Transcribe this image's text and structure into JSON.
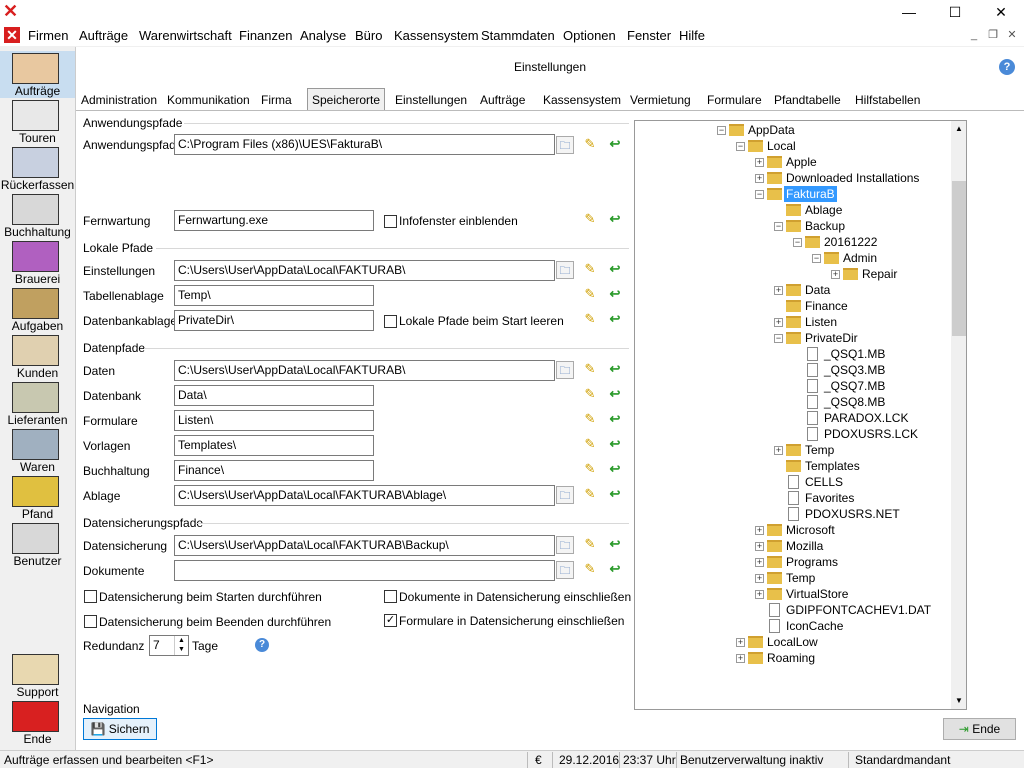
{
  "window": {
    "minimize": "—",
    "maximize": "☐",
    "close": "✕",
    "mdi_min": "_",
    "mdi_restore": "❐",
    "mdi_close": "✕"
  },
  "menu": [
    "Firmen",
    "Aufträge",
    "Warenwirtschaft",
    "Finanzen",
    "Analyse",
    "Büro",
    "Kassensystem",
    "Stammdaten",
    "Optionen",
    "Fenster",
    "Hilfe"
  ],
  "sidebar": [
    "Aufträge",
    "Touren",
    "Rückerfassen",
    "Buchhaltung",
    "Brauerei",
    "Aufgaben",
    "Kunden",
    "Lieferanten",
    "Waren",
    "Pfand",
    "Benutzer"
  ],
  "sidebar_bottom": [
    "Support",
    "Ende"
  ],
  "content_title": "Einstellungen",
  "tabs": [
    "Administration",
    "Kommunikation",
    "Firma",
    "Speicherorte",
    "Einstellungen",
    "Aufträge",
    "Kassensystem",
    "Vermietung",
    "Formulare",
    "Pfandtabelle",
    "Hilfstabellen"
  ],
  "active_tab": "Speicherorte",
  "groups": {
    "anwendung": {
      "title": "Anwendungspfade",
      "anwendungspfad_label": "Anwendungspfad",
      "anwendungspfad_value": "C:\\Program Files (x86)\\UES\\FakturaB\\",
      "fernwartung_label": "Fernwartung",
      "fernwartung_value": "Fernwartung.exe",
      "infofenster_label": "Infofenster einblenden"
    },
    "lokal": {
      "title": "Lokale Pfade",
      "einstellungen_label": "Einstellungen",
      "einstellungen_value": "C:\\Users\\User\\AppData\\Local\\FAKTURAB\\",
      "tabellenablage_label": "Tabellenablage",
      "tabellenablage_value": "Temp\\",
      "datenbankablage_label": "Datenbankablage",
      "datenbankablage_value": "PrivateDir\\",
      "lokale_check_label": "Lokale Pfade beim Start leeren"
    },
    "daten": {
      "title": "Datenpfade",
      "rows": [
        {
          "label": "Daten",
          "value": "C:\\Users\\User\\AppData\\Local\\FAKTURAB\\"
        },
        {
          "label": "Datenbank",
          "value": "Data\\"
        },
        {
          "label": "Formulare",
          "value": "Listen\\"
        },
        {
          "label": "Vorlagen",
          "value": "Templates\\"
        },
        {
          "label": "Buchhaltung",
          "value": "Finance\\"
        },
        {
          "label": "Ablage",
          "value": "C:\\Users\\User\\AppData\\Local\\FAKTURAB\\Ablage\\"
        }
      ]
    },
    "sicherung": {
      "title": "Datensicherungspfade",
      "datensicherung_label": "Datensicherung",
      "datensicherung_value": "C:\\Users\\User\\AppData\\Local\\FAKTURAB\\Backup\\",
      "dokumente_label": "Dokumente",
      "dokumente_value": "",
      "chk1": "Datensicherung beim Starten durchführen",
      "chk2": "Datensicherung beim Beenden durchführen",
      "chk3": "Dokumente in Datensicherung einschließen",
      "chk4": "Formulare in Datensicherung einschließen",
      "chk4_checked": true,
      "redundanz_label": "Redundanz",
      "redundanz_value": "7",
      "tage_label": "Tage"
    }
  },
  "tree": [
    {
      "label": "AppData",
      "level": 0,
      "type": "folder",
      "exp": "−"
    },
    {
      "label": "Local",
      "level": 1,
      "type": "folder",
      "exp": "−"
    },
    {
      "label": "Apple",
      "level": 2,
      "type": "folder",
      "exp": "+"
    },
    {
      "label": "Downloaded Installations",
      "level": 2,
      "type": "folder",
      "exp": "+"
    },
    {
      "label": "FakturaB",
      "level": 2,
      "type": "folder",
      "exp": "−",
      "selected": true
    },
    {
      "label": "Ablage",
      "level": 3,
      "type": "folder",
      "exp": ""
    },
    {
      "label": "Backup",
      "level": 3,
      "type": "folder",
      "exp": "−"
    },
    {
      "label": "20161222",
      "level": 4,
      "type": "folder",
      "exp": "−"
    },
    {
      "label": "Admin",
      "level": 5,
      "type": "folder",
      "exp": "−"
    },
    {
      "label": "Repair",
      "level": 6,
      "type": "folder",
      "exp": "+"
    },
    {
      "label": "Data",
      "level": 3,
      "type": "folder",
      "exp": "+"
    },
    {
      "label": "Finance",
      "level": 3,
      "type": "folder",
      "exp": ""
    },
    {
      "label": "Listen",
      "level": 3,
      "type": "folder",
      "exp": "+"
    },
    {
      "label": "PrivateDir",
      "level": 3,
      "type": "folder",
      "exp": "−"
    },
    {
      "label": "_QSQ1.MB",
      "level": 4,
      "type": "file",
      "exp": ""
    },
    {
      "label": "_QSQ3.MB",
      "level": 4,
      "type": "file",
      "exp": ""
    },
    {
      "label": "_QSQ7.MB",
      "level": 4,
      "type": "file",
      "exp": ""
    },
    {
      "label": "_QSQ8.MB",
      "level": 4,
      "type": "file",
      "exp": ""
    },
    {
      "label": "PARADOX.LCK",
      "level": 4,
      "type": "file",
      "exp": ""
    },
    {
      "label": "PDOXUSRS.LCK",
      "level": 4,
      "type": "file",
      "exp": ""
    },
    {
      "label": "Temp",
      "level": 3,
      "type": "folder",
      "exp": "+"
    },
    {
      "label": "Templates",
      "level": 3,
      "type": "folder",
      "exp": ""
    },
    {
      "label": "CELLS",
      "level": 3,
      "type": "file",
      "exp": ""
    },
    {
      "label": "Favorites",
      "level": 3,
      "type": "file",
      "exp": ""
    },
    {
      "label": "PDOXUSRS.NET",
      "level": 3,
      "type": "file",
      "exp": ""
    },
    {
      "label": "Microsoft",
      "level": 2,
      "type": "folder",
      "exp": "+"
    },
    {
      "label": "Mozilla",
      "level": 2,
      "type": "folder",
      "exp": "+"
    },
    {
      "label": "Programs",
      "level": 2,
      "type": "folder",
      "exp": "+"
    },
    {
      "label": "Temp",
      "level": 2,
      "type": "folder",
      "exp": "+"
    },
    {
      "label": "VirtualStore",
      "level": 2,
      "type": "folder",
      "exp": "+"
    },
    {
      "label": "GDIPFONTCACHEV1.DAT",
      "level": 2,
      "type": "file",
      "exp": ""
    },
    {
      "label": "IconCache",
      "level": 2,
      "type": "file",
      "exp": ""
    },
    {
      "label": "LocalLow",
      "level": 1,
      "type": "folder",
      "exp": "+"
    },
    {
      "label": "Roaming",
      "level": 1,
      "type": "folder",
      "exp": "+"
    }
  ],
  "navigation_label": "Navigation",
  "sichern_label": "Sichern",
  "ende_label": "Ende",
  "status": {
    "hint": "Aufträge erfassen und bearbeiten <F1>",
    "currency": "€",
    "date": "29.12.2016",
    "time": "23:37 Uhr",
    "user": "Benutzerverwaltung inaktiv",
    "mandant": "Standardmandant"
  }
}
